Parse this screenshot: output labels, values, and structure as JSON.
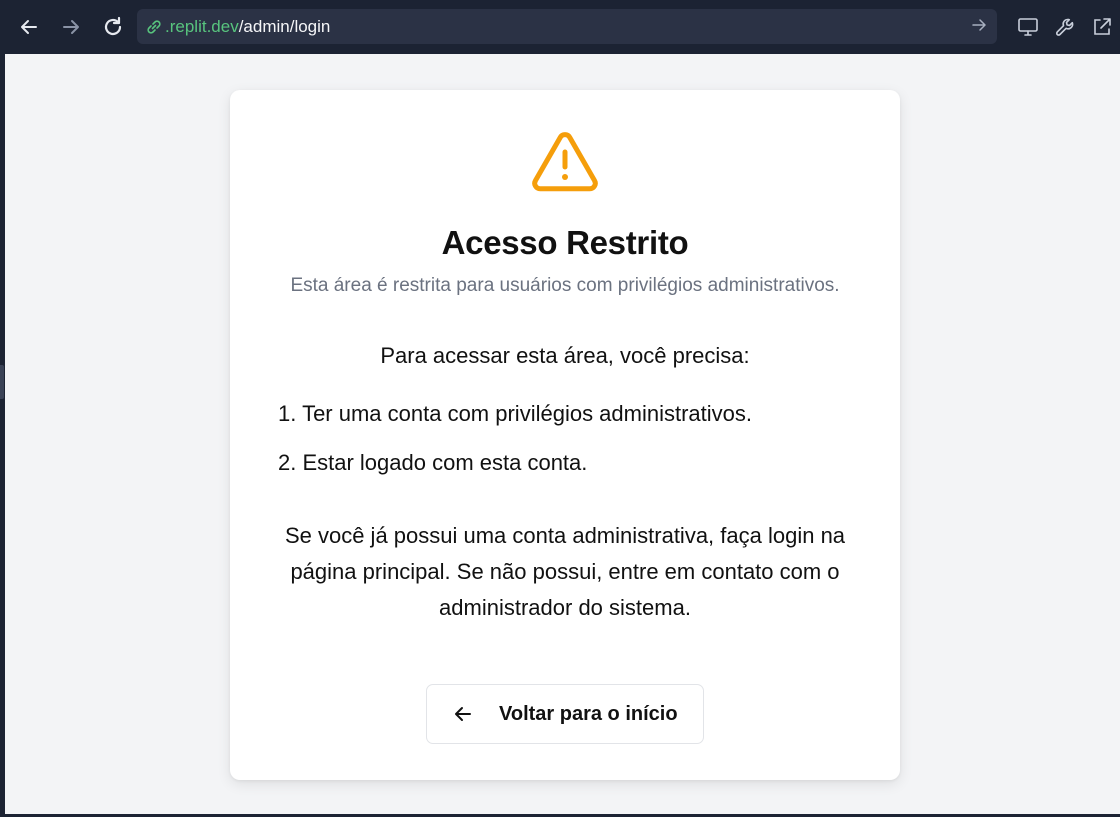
{
  "browser": {
    "url_host": ".replit.dev",
    "url_path": "/admin/login",
    "icons": [
      "back-arrow-icon",
      "forward-arrow-icon",
      "reload-icon",
      "link-icon",
      "go-arrow-icon",
      "monitor-icon",
      "wrench-icon",
      "external-link-icon"
    ]
  },
  "card": {
    "icon": "warning-triangle-icon",
    "icon_color": "#f59e0b",
    "title": "Acesso Restrito",
    "subtitle": "Esta área é restrita para usuários com privilégios administrativos.",
    "intro": "Para acessar esta área, você precisa:",
    "requirements": [
      "1. Ter uma conta com privilégios administrativos.",
      "2. Estar logado com esta conta."
    ],
    "note": "Se você já possui uma conta administrativa, faça login na página principal. Se não possui, entre em contato com o administrador do sistema.",
    "back_button_label": "Voltar para o início"
  }
}
